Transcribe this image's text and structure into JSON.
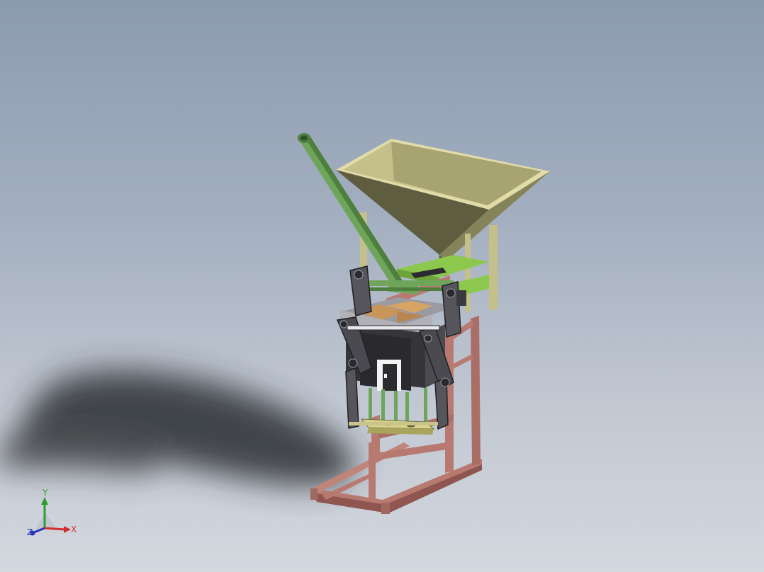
{
  "view": {
    "description_free": true,
    "background_gradient": [
      "#8b9bb0",
      "#a3afc0",
      "#c3c9d3",
      "#d3d7de"
    ]
  },
  "model": {
    "parts": [
      "frame-base",
      "frame-uprights",
      "hopper",
      "feed-tube",
      "mold-box",
      "press-lever-left",
      "press-lever-right",
      "lid-plate",
      "bottom-tray",
      "ejector-rods"
    ],
    "colors": {
      "frame": "#b87a70",
      "frame_dark": "#8f564f",
      "hopper_outer": "#6a6a48",
      "hopper_inner": "#c5c089",
      "hopper_rim": "#e2dca8",
      "tube": "#6fa55a",
      "tube_dark": "#4e7f3e",
      "mold": "#2c2c30",
      "lever": "#4a4a50",
      "lid": "#c99659",
      "tray": "#d9d48a",
      "green_parts": "#8dc84e"
    }
  },
  "triad": {
    "x_label": "X",
    "y_label": "Y",
    "z_label": "Z",
    "x_color": "#d23030",
    "y_color": "#2f9b2f",
    "z_color": "#2a33b8"
  }
}
